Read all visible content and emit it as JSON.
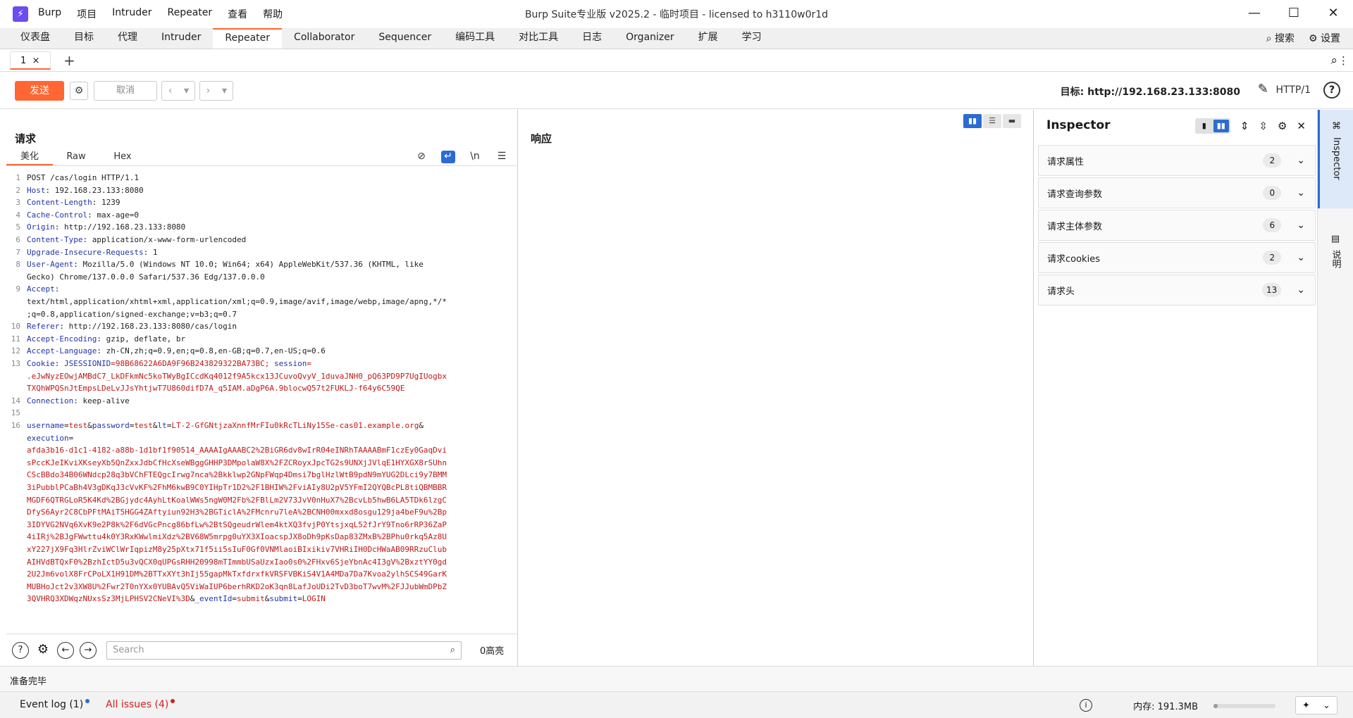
{
  "app": {
    "logo": "⚡",
    "menu": [
      "Burp",
      "项目",
      "Intruder",
      "Repeater",
      "查看",
      "帮助"
    ],
    "window_title": "Burp Suite专业版  v2025.2 - 临时项目 - licensed to h3110w0r1d",
    "window_controls": [
      "—",
      "☐",
      "✕"
    ]
  },
  "main_tabs": [
    "仪表盘",
    "目标",
    "代理",
    "Intruder",
    "Repeater",
    "Collaborator",
    "Sequencer",
    "编码工具",
    "对比工具",
    "日志",
    "Organizer",
    "扩展",
    "学习"
  ],
  "main_tab_active": "Repeater",
  "top_right": {
    "search": "搜索",
    "settings": "设置"
  },
  "repeater_tab": {
    "label": "1",
    "close": "×",
    "add": "+"
  },
  "toolbar": {
    "send": "发送",
    "cancel": "取消",
    "target": "目标: http://192.168.23.133:8080",
    "http": "HTTP/1",
    "help": "?"
  },
  "request": {
    "title": "请求",
    "tabs": [
      "美化",
      "Raw",
      "Hex"
    ],
    "lines": [
      {
        "n": "1",
        "k": "",
        "v": "POST /cas/login HTTP/1.1"
      },
      {
        "n": "2",
        "k": "Host",
        "v": ": 192.168.23.133:8080"
      },
      {
        "n": "3",
        "k": "Content-Length",
        "v": ": 1239"
      },
      {
        "n": "4",
        "k": "Cache-Control",
        "v": ": max-age=0"
      },
      {
        "n": "5",
        "k": "Origin",
        "v": ": http://192.168.23.133:8080"
      },
      {
        "n": "6",
        "k": "Content-Type",
        "v": ": application/x-www-form-urlencoded"
      },
      {
        "n": "7",
        "k": "Upgrade-Insecure-Requests",
        "v": ": 1"
      },
      {
        "n": "8",
        "k": "User-Agent",
        "v": ": Mozilla/5.0 (Windows NT 10.0; Win64; x64) AppleWebKit/537.36 (KHTML, like"
      },
      {
        "n": "",
        "k": "",
        "v": "Gecko) Chrome/137.0.0.0 Safari/537.36 Edg/137.0.0.0"
      },
      {
        "n": "9",
        "k": "Accept",
        "v": ":"
      },
      {
        "n": "",
        "k": "",
        "v": "text/html,application/xhtml+xml,application/xml;q=0.9,image/avif,image/webp,image/apng,*/*"
      },
      {
        "n": "",
        "k": "",
        "v": ";q=0.8,application/signed-exchange;v=b3;q=0.7"
      },
      {
        "n": "10",
        "k": "Referer",
        "v": ": http://192.168.23.133:8080/cas/login"
      },
      {
        "n": "11",
        "k": "Accept-Encoding",
        "v": ": gzip, deflate, br"
      },
      {
        "n": "12",
        "k": "Accept-Language",
        "v": ": zh-CN,zh;q=0.9,en;q=0.8,en-GB;q=0.7,en-US;q=0.6"
      }
    ],
    "cookie_line": {
      "n": "13",
      "k": "Cookie",
      "v1": ": ",
      "c1": "JSESSIONID",
      "v2": "=98B68622A6DA9F96B243829322BA73BC; ",
      "c2": "session",
      "v3": "="
    },
    "cookie_cont": [
      ".eJwNyzEOwjAMBdC7_LkDFkmNc5koTWyBgICcdKq4012f9A5kcx13JCuvoQvyV_1duvaJNH0_pQ63PD9P7UgIUogbx",
      "TXQhWPQSnJtEmpsLDeLvJJsYhtjwT7U860difD7A_q5IAM.aDgP6A.9blocwQ57t2FUKLJ-f64y6C59QE"
    ],
    "line14": {
      "n": "14",
      "k": "Connection",
      "v": ": keep-alive"
    },
    "line15": "15",
    "body_line": {
      "n": "16",
      "k1": "username",
      "v1": "test",
      "k2": "password",
      "v2": "test",
      "k3": "lt",
      "v3": "LT-2-GfGNtjzaXnnfMrFIu0kRcTLiNy15Se-cas01.example.org",
      "k4": "execution"
    },
    "body_cont": [
      "afda3b16-d1c1-4182-a88b-1d1bf1f90514_AAAAIgAAABC2%2BiGR6dv8wIrR04eINRhTAAAABmF1czEy0GaqDvi",
      "sPccKJeIKviXKseyXb5QnZxxJdbCfHcXseWBggGHHP3DMpolaW8X%2FZCRoyxJpcTG2s9UNXjJVlqE1HYXGX8rSUhn",
      "CScBBdo34B06WNdcp28q3bVChFTEQgcIrwg7nca%2Bkklwp2GNpFWqp4Dmsi7bglHzlWtB9pdN9mYUG2DLci9y7BMM",
      "3iPubblPCaBh4V3gDKqJ3cVvKF%2FhM6kwB9C0YIHpTr1D2%2F1BHIW%2FviAIy8U2pV5YFmI2QYQBcPL8tiQBMBBR",
      "MGDF6QTRGLoR5K4Kd%2BGjydc4AyhLtKoalWWs5ngW0M2Fb%2FBlLm2V73JvV0nHuX7%2BcvLb5hwB6LA5TDk6lzgC",
      "DfyS6Ayr2C8CbPFtMAiT5HGG4ZAftyiun92H3%2BGTiclA%2FMcnru7leA%2BCNH00mxxd8osgu129ja4beF9u%2Bp",
      "3IDYVG2NVq6XvK9e2P8k%2F6dVGcPncg86bfLw%2BtSQgeudrWlem4ktXQ3fvjP0YtsjxqL52fJrY9Tno6rRP36ZaP",
      "4iIRj%2BJgFWwttu4k0Y3RxKWwlmiXdz%2BV68W5mrpg0uYX3XIoacspJX8oDh9pKsDap83ZMxB%2BPhu0rkq5Az8U",
      "xY227jX9Fq3HlrZviWClWrIqpizM8y25pXtx71f5ii5sIuF0Gf0VNMlaoiBIxikiv7VHRiIH0DcHWaAB09RRzuClub",
      "AIHVdBTQxF0%2BzhIctD5u3vQCX0qUPGsRHH20998mTImmbUSaUzxIao0s0%2FHxv6SjeYbnAc4I3gV%2BxztYY0gd",
      "2U2Jm6volX8FrCPoLX1H91DM%2BTTxXYt3hIj55gapMkTxfdrxfkVRSFVBKiS4V1A4MDa7Da7Kvoa2ylhSCS49GarK",
      "MUBHoJct2v3XW8U%2Fwr2T0nYXx0YUBAvQ5ViWaIUP6berhRKD2oK3qn8LafJoUDi2TvD3boT7wvM%2FJJubWmDPbZ",
      "3QVHRQ3XDWqzNUxsSz3MjLPHSV2CNeVI%3D"
    ],
    "body_tail": {
      "k5": "_eventId",
      "v5": "submit",
      "k6": "submit",
      "v6": "LOGIN"
    },
    "search_placeholder": "Search",
    "highlights": "0高亮"
  },
  "response": {
    "title": "响应"
  },
  "inspector": {
    "title": "Inspector",
    "sections": [
      {
        "label": "请求属性",
        "count": "2"
      },
      {
        "label": "请求查询参数",
        "count": "0"
      },
      {
        "label": "请求主体参数",
        "count": "6"
      },
      {
        "label": "请求cookies",
        "count": "2"
      },
      {
        "label": "请求头",
        "count": "13"
      }
    ]
  },
  "sidebar": {
    "tab1": "Inspector",
    "tab2": "说明"
  },
  "status": "准备完毕",
  "bottom": {
    "event_log": "Event log (1)",
    "issues": "All issues (4)",
    "memory": "内存: 191.3MB",
    "event_dot_color": "#2b6cd4",
    "issues_dot_color": "#d42020"
  }
}
